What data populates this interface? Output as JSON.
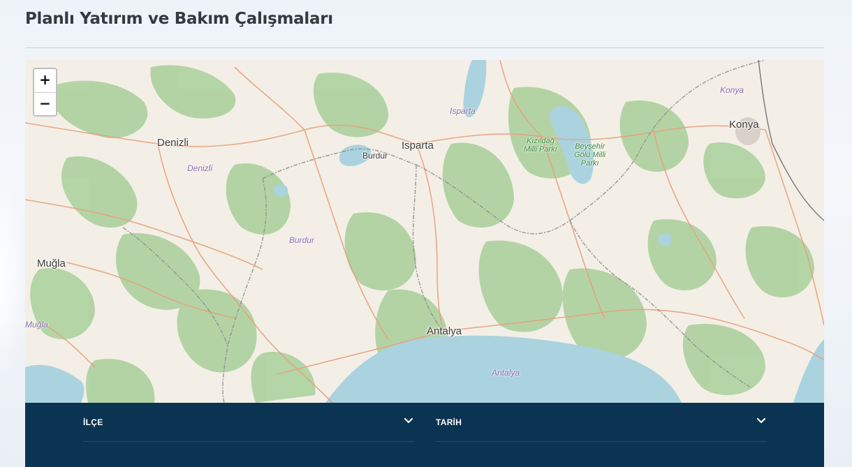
{
  "page": {
    "title": "Planlı Yatırım ve Bakım Çalışmaları"
  },
  "map": {
    "zoom_in_label": "+",
    "zoom_out_label": "−",
    "cities": {
      "denizli": "Denizli",
      "isparta": "Isparta",
      "burdur": "Burdur",
      "konya": "Konya",
      "mugla": "Muğla",
      "antalya": "Antalya"
    },
    "regions": {
      "denizli": "Denizli",
      "isparta": "Isparta",
      "burdur": "Burdur",
      "konya": "Konya",
      "mugla": "Muğla",
      "antalya": "Antalya"
    },
    "parks": {
      "kizildag": "Kızıldağ\nMilli Parkı",
      "beysehir": "Beyşehir\nGölü Milli\nParkı"
    },
    "colors": {
      "land": "#f3efe6",
      "forest": "#add19e",
      "water": "#aad3df",
      "road": "#e8a07c",
      "border": "#8e8e8e"
    }
  },
  "filters": {
    "ilce_label": "İLÇE",
    "tarih_label": "TARİH"
  },
  "colors": {
    "filter_bar": "#0b3452"
  }
}
